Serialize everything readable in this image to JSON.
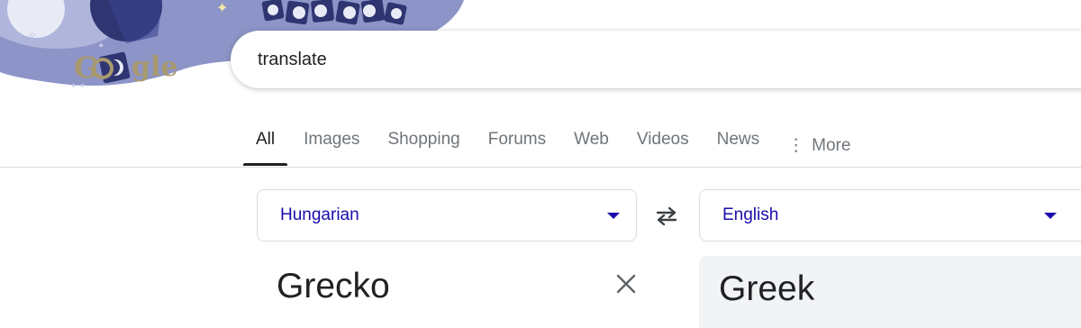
{
  "header": {
    "logo_text": "Google",
    "doodle_icon": "moon-phases-doodle-icon"
  },
  "search": {
    "value": "translate"
  },
  "tabs": [
    {
      "label": "All",
      "active": true
    },
    {
      "label": "Images"
    },
    {
      "label": "Shopping"
    },
    {
      "label": "Forums"
    },
    {
      "label": "Web"
    },
    {
      "label": "Videos"
    },
    {
      "label": "News"
    },
    {
      "label": "More",
      "icon": "vertical-dots-icon"
    }
  ],
  "translator": {
    "source_language": "Hungarian",
    "target_language": "English",
    "source_text": "Grecko",
    "translated_text": "Greek",
    "swap_icon": "swap-arrows-icon",
    "clear_icon": "close-icon",
    "dropdown_icon": "caret-down-icon"
  },
  "colors": {
    "link_blue": "#1a0dab",
    "doodle_purple": "#8d94c8",
    "text_dark": "#202124",
    "text_gray": "#70757a"
  }
}
